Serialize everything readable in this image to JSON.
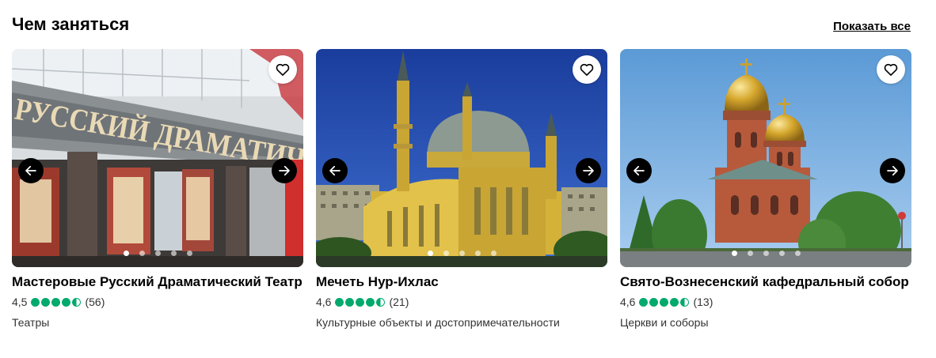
{
  "section": {
    "title": "Чем заняться",
    "show_all": "Показать все"
  },
  "colors": {
    "rating_bubble": "#00aa6c",
    "arrow_button": "#000000"
  },
  "cards": [
    {
      "title": "Мастеровые Русский Драматический Театр",
      "rating": "4,5",
      "bubbles": [
        1,
        1,
        1,
        1,
        0.5
      ],
      "reviews": "(56)",
      "category": "Театры",
      "photo_dots": 5,
      "active_dot": 1
    },
    {
      "title": "Мечеть Нур-Ихлас",
      "rating": "4,6",
      "bubbles": [
        1,
        1,
        1,
        1,
        0.5
      ],
      "reviews": "(21)",
      "category": "Культурные объекты и достопримечательности",
      "photo_dots": 5,
      "active_dot": 1
    },
    {
      "title": "Свято-Вознесенский кафедральный собор",
      "rating": "4,6",
      "bubbles": [
        1,
        1,
        1,
        1,
        0.5
      ],
      "reviews": "(13)",
      "category": "Церкви и соборы",
      "photo_dots": 5,
      "active_dot": 1
    }
  ],
  "icons": {
    "favorite": "heart-outline-icon",
    "prev": "arrow-left-icon",
    "next": "arrow-right-icon"
  },
  "photos": {
    "theater_sign": "РУССКИЙ ДРАМАТИЧЕСКИЙ ТЕАТР"
  }
}
